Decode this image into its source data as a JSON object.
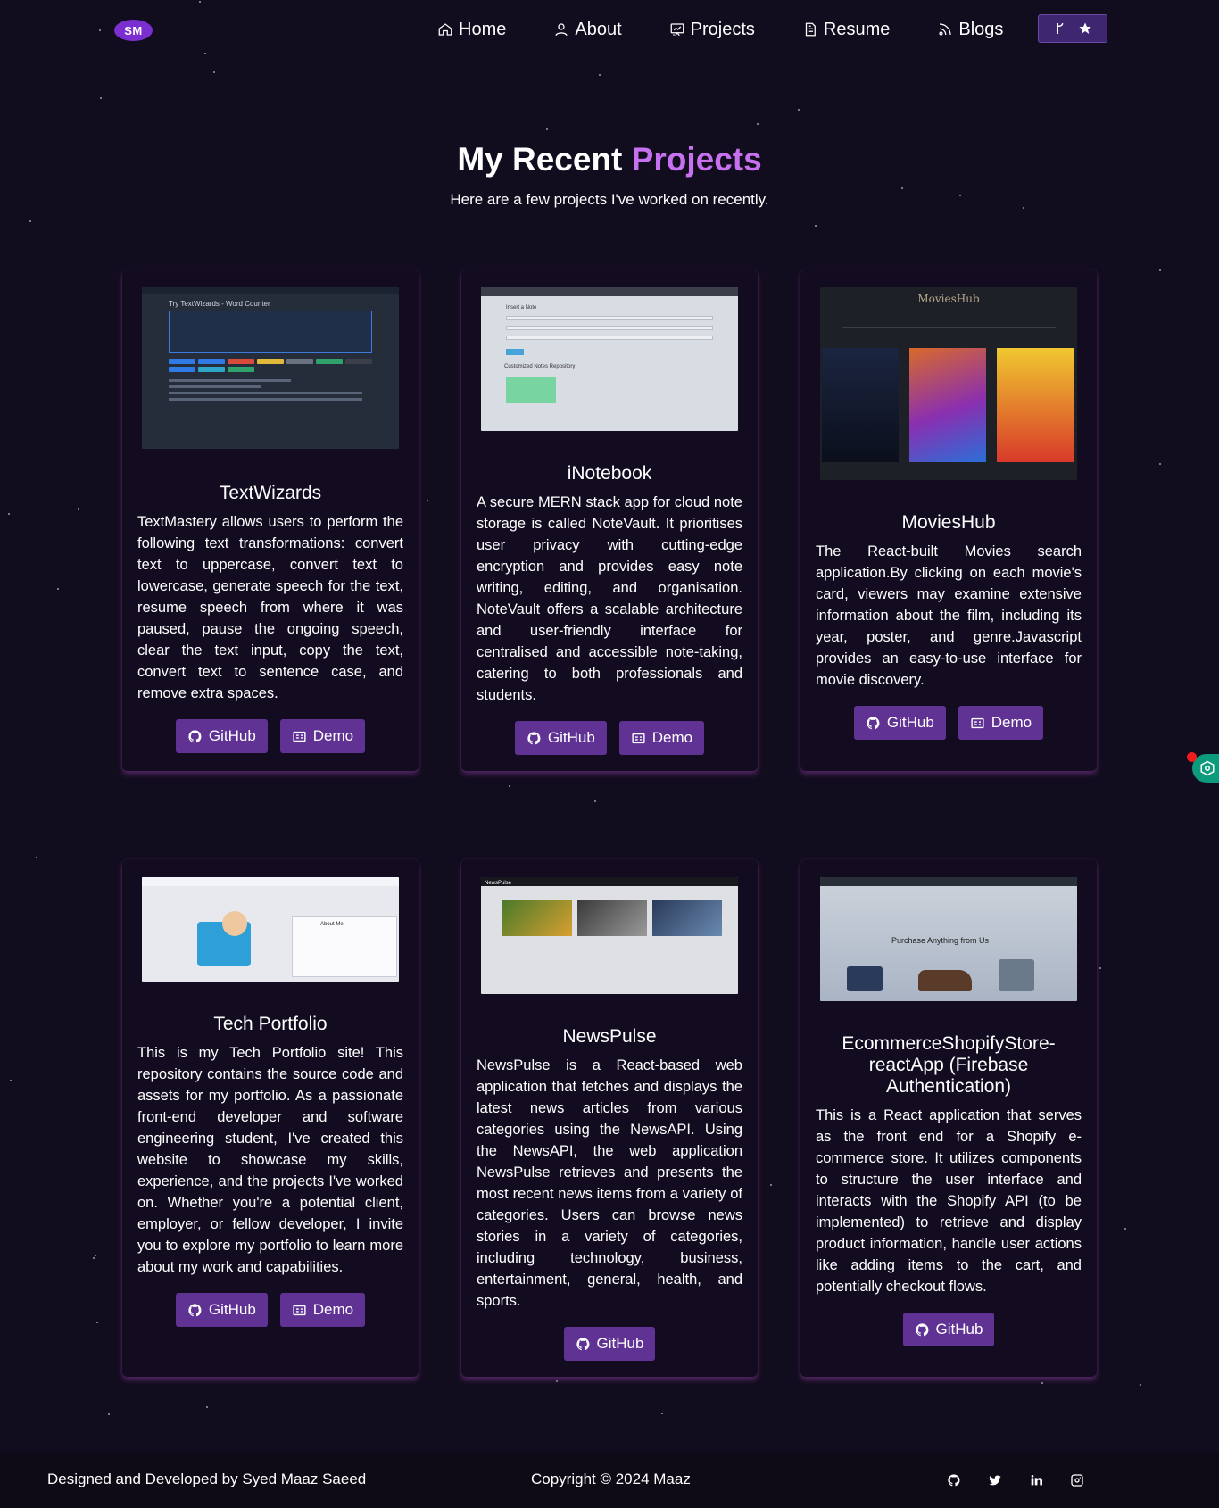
{
  "nav": {
    "logo": "SM",
    "items": [
      {
        "label": "Home",
        "icon": "home-icon"
      },
      {
        "label": "About",
        "icon": "user-icon"
      },
      {
        "label": "Projects",
        "icon": "projects-icon"
      },
      {
        "label": "Resume",
        "icon": "document-icon"
      },
      {
        "label": "Blogs",
        "icon": "rss-icon"
      }
    ]
  },
  "header": {
    "title_prefix": "My Recent",
    "title_accent": "Projects",
    "subtitle": "Here are a few projects I've worked on recently."
  },
  "projects": [
    {
      "title": "TextWizards",
      "description": "TextMastery allows users to perform the following text transformations: convert text to uppercase, convert text to lowercase, generate speech for the text, resume speech from where it was paused, pause the ongoing speech, clear the text input, copy the text, convert text to sentence case, and remove extra spaces.",
      "thumb_text": "Try TextWizards - Word Counter",
      "github_label": "GitHub",
      "demo_label": "Demo"
    },
    {
      "title": "iNotebook",
      "description": "A secure MERN stack app for cloud note storage is called NoteVault. It prioritises user privacy with cutting-edge encryption and provides easy note writing, editing, and organisation. NoteVault offers a scalable architecture and user-friendly interface for centralised and accessible note-taking, catering to both professionals and students.",
      "thumb_text": "Insert a Note",
      "thumb_text2": "Customized Notes Repository",
      "github_label": "GitHub",
      "demo_label": "Demo"
    },
    {
      "title": "MoviesHub",
      "description": "The React-built Movies search application.By clicking on each movie's card, viewers may examine extensive information about the film, including its year, poster, and genre.Javascript provides an easy-to-use interface for movie discovery.",
      "thumb_text": "MoviesHub",
      "github_label": "GitHub",
      "demo_label": "Demo"
    },
    {
      "title": "Tech Portfolio",
      "description": "This is my Tech Portfolio site! This repository contains the source code and assets for my portfolio. As a passionate front-end developer and software engineering student, I've created this website to showcase my skills, experience, and the projects I've worked on. Whether you're a potential client, employer, or fellow developer, I invite you to explore my portfolio to learn more about my work and capabilities.",
      "thumb_text": "About Me",
      "github_label": "GitHub",
      "demo_label": "Demo"
    },
    {
      "title": "NewsPulse",
      "description": "NewsPulse is a React-based web application that fetches and displays the latest news articles from various categories using the NewsAPI. Using the NewsAPI, the web application NewsPulse retrieves and presents the most recent news items from a variety of categories. Users can browse news stories in a variety of categories, including technology, business, entertainment, general, health, and sports.",
      "thumb_text": "NewsPulse",
      "github_label": "GitHub"
    },
    {
      "title": "EcommerceShopifyStore-reactApp (Firebase Authentication)",
      "description": "This is a React application that serves as the front end for a Shopify e-commerce store. It utilizes components to structure the user interface and interacts with the Shopify API (to be implemented) to retrieve and display product information, handle user actions like adding items to the cart, and potentially checkout flows.",
      "thumb_text": "Purchase Anything from Us",
      "github_label": "GitHub"
    }
  ],
  "footer": {
    "designed_by": "Designed and Developed by Syed Maaz Saeed",
    "copyright": "Copyright © 2024 Maaz",
    "socials": [
      "github-icon",
      "twitter-icon",
      "linkedin-icon",
      "instagram-icon"
    ]
  },
  "colors": {
    "background": "#120d1e",
    "accent": "#c770f0",
    "button": "#5f3294"
  }
}
